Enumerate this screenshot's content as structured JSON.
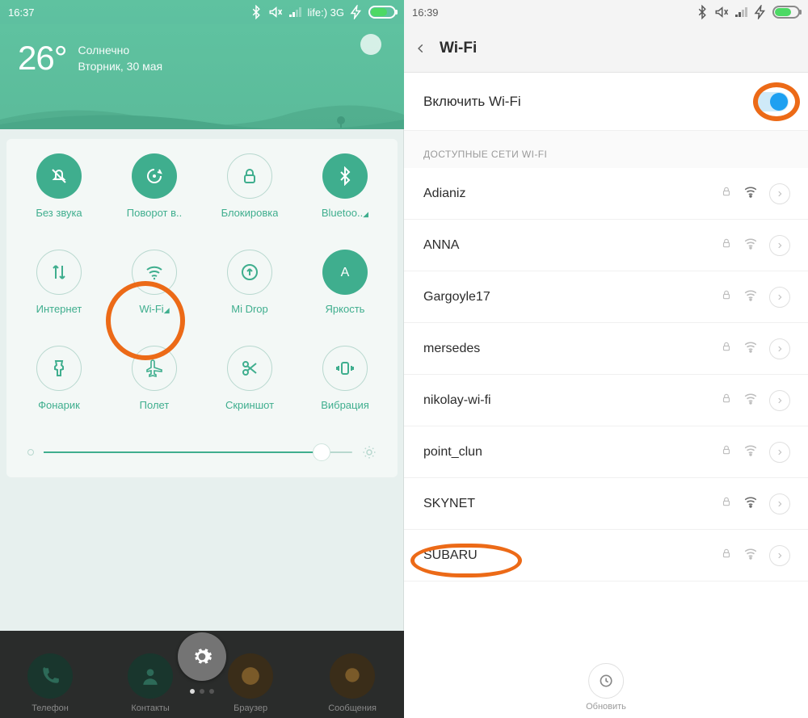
{
  "left": {
    "status": {
      "time": "16:37",
      "carrier": "life:) 3G"
    },
    "weather": {
      "temp": "26°",
      "cond": "Солнечно",
      "date": "Вторник, 30 мая"
    },
    "tiles": [
      {
        "id": "silent",
        "label": "Без звука",
        "on": true,
        "icon": "bell-off"
      },
      {
        "id": "rotate",
        "label": "Поворот в..",
        "on": true,
        "icon": "rotate"
      },
      {
        "id": "lock",
        "label": "Блокировка",
        "on": false,
        "icon": "lock"
      },
      {
        "id": "bt",
        "label": "Bluetoo..",
        "on": true,
        "icon": "bluetooth",
        "expand": true
      },
      {
        "id": "data",
        "label": "Интернет",
        "on": false,
        "icon": "data"
      },
      {
        "id": "wifi",
        "label": "Wi-Fi",
        "on": false,
        "icon": "wifi",
        "expand": true
      },
      {
        "id": "midrop",
        "label": "Mi Drop",
        "on": false,
        "icon": "midrop"
      },
      {
        "id": "bright",
        "label": "Яркость",
        "on": true,
        "icon": "brightness"
      },
      {
        "id": "torch",
        "label": "Фонарик",
        "on": false,
        "icon": "torch"
      },
      {
        "id": "plane",
        "label": "Полет",
        "on": false,
        "icon": "plane"
      },
      {
        "id": "shot",
        "label": "Скриншот",
        "on": false,
        "icon": "scissors"
      },
      {
        "id": "vibe",
        "label": "Вибрация",
        "on": false,
        "icon": "vibrate"
      }
    ],
    "dock": [
      {
        "label": "Телефон"
      },
      {
        "label": "Контакты"
      },
      {
        "label": "Браузер"
      },
      {
        "label": "Сообщения"
      }
    ]
  },
  "right": {
    "status": {
      "time": "16:39"
    },
    "title": "Wi-Fi",
    "enable_label": "Включить Wi-Fi",
    "enabled": true,
    "section": "ДОСТУПНЫЕ СЕТИ WI-FI",
    "networks": [
      {
        "name": "Adianiz",
        "locked": true,
        "strength": "strong"
      },
      {
        "name": "ANNA",
        "locked": true,
        "strength": "weak"
      },
      {
        "name": "Gargoyle17",
        "locked": true,
        "strength": "weak"
      },
      {
        "name": "mersedes",
        "locked": true,
        "strength": "weak"
      },
      {
        "name": "nikolay-wi-fi",
        "locked": true,
        "strength": "weak"
      },
      {
        "name": "point_clun",
        "locked": true,
        "strength": "weak"
      },
      {
        "name": "SKYNET",
        "locked": true,
        "strength": "strong"
      },
      {
        "name": "SUBARU",
        "locked": true,
        "strength": "weak"
      }
    ],
    "refresh_label": "Обновить"
  }
}
